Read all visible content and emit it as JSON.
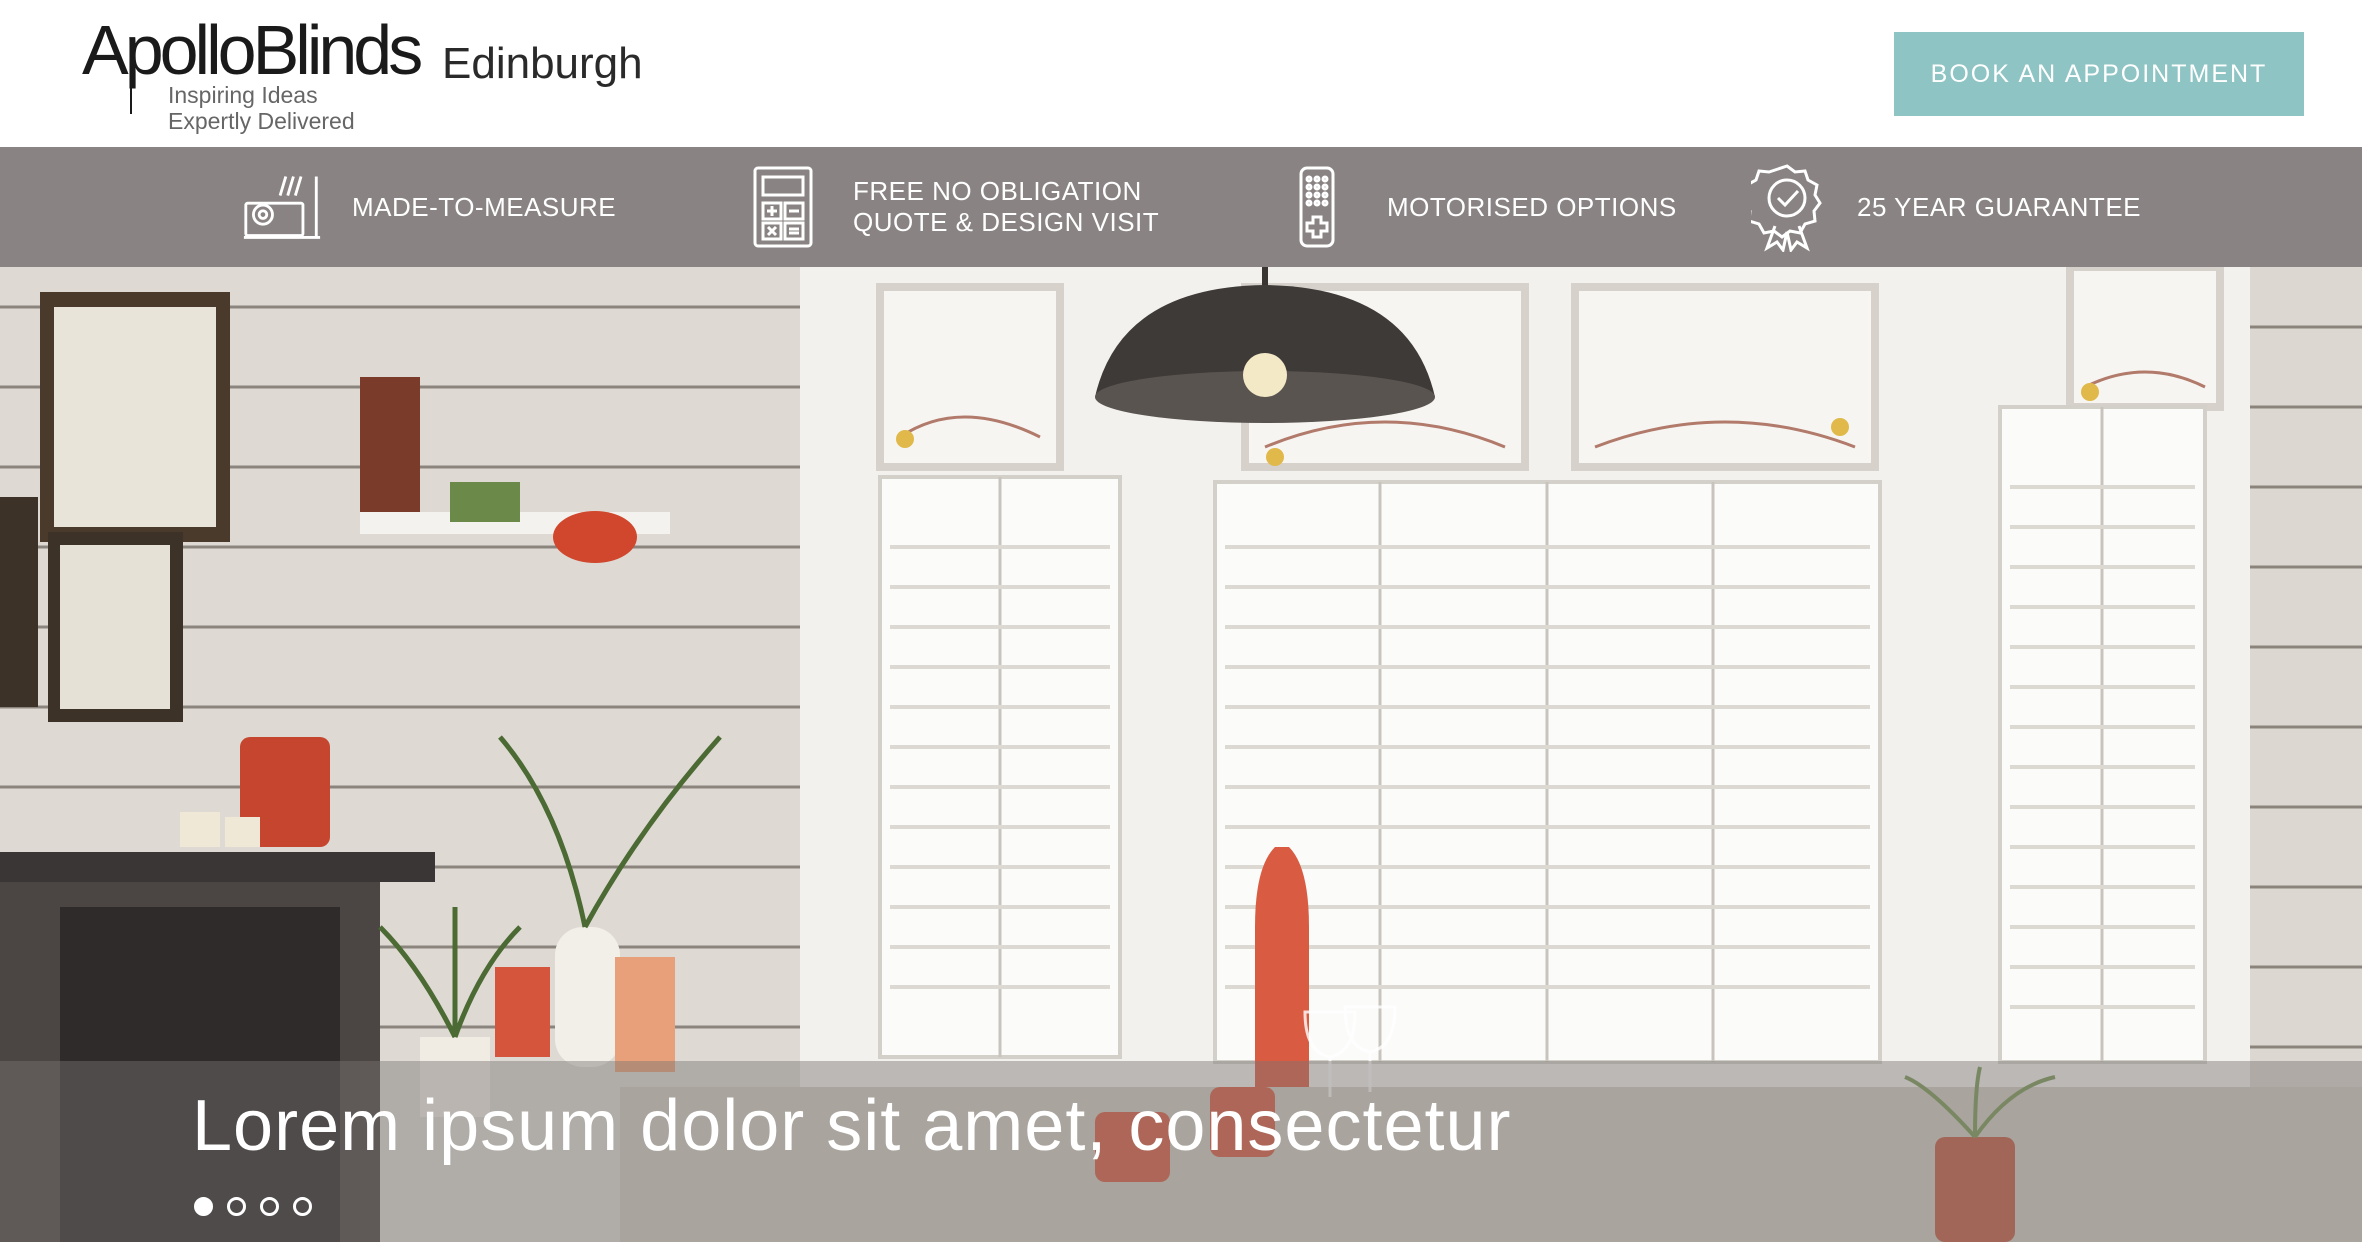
{
  "header": {
    "logo_main": "ApolloBlinds",
    "logo_location": "Edinburgh",
    "logo_tagline_1": "Inspiring Ideas",
    "logo_tagline_2": "Expertly Delivered",
    "book_button": "BOOK AN APPOINTMENT"
  },
  "features": [
    {
      "icon": "tape-measure-icon",
      "label": "MADE-TO-MEASURE"
    },
    {
      "icon": "calculator-icon",
      "label": "FREE NO OBLIGATION\nQUOTE & DESIGN VISIT"
    },
    {
      "icon": "remote-control-icon",
      "label": "MOTORISED OPTIONS"
    },
    {
      "icon": "award-badge-icon",
      "label": "25 YEAR GUARANTEE"
    }
  ],
  "hero": {
    "caption": "Lorem ipsum dolor sit amet, consectetur",
    "slide_count": 4,
    "active_slide": 1
  },
  "colors": {
    "accent_button": "#8fc4c5",
    "feature_bar": "#8a8383",
    "header_bg": "#ffffff"
  }
}
